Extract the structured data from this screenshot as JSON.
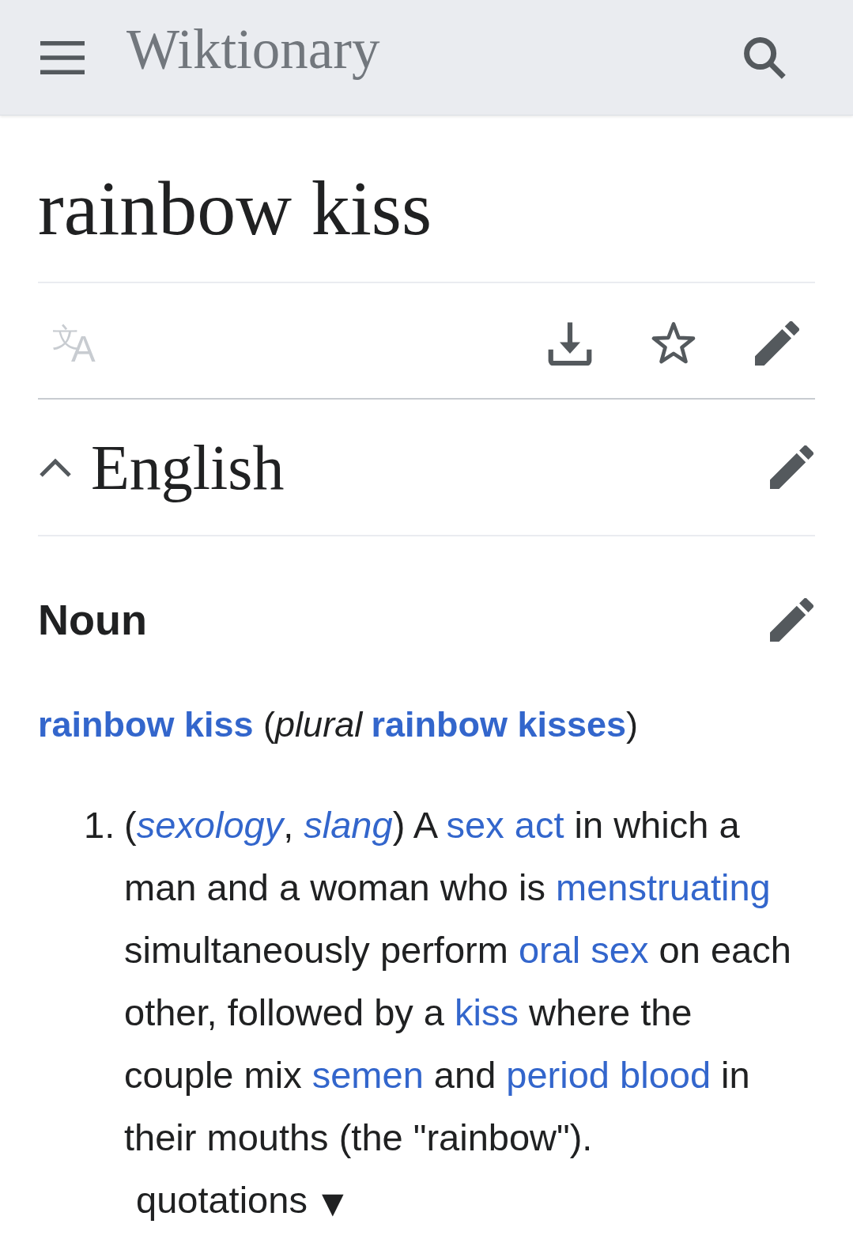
{
  "header": {
    "title": "Wiktionary"
  },
  "page": {
    "title": "rainbow kiss"
  },
  "page_actions": [
    {
      "kind": "language",
      "symbol": "文A",
      "disabled": true
    },
    {
      "kind": "download",
      "disabled": false
    },
    {
      "kind": "watch",
      "disabled": false
    },
    {
      "kind": "edit",
      "disabled": false
    }
  ],
  "section": {
    "heading": "English",
    "expanded": true,
    "subsections": [
      {
        "heading": "Noun",
        "headword_line": [
          {
            "kind": "headword",
            "text": "rainbow kiss"
          },
          {
            "kind": "text",
            "text": " ("
          },
          {
            "kind": "gloss",
            "text": "plural"
          },
          {
            "kind": "headword",
            "text": "rainbow kisses"
          },
          {
            "kind": "text",
            "text": ")"
          }
        ],
        "senses": [
          {
            "number": "1.",
            "segments": [
              {
                "kind": "text",
                "text": "("
              },
              {
                "kind": "label",
                "text": "sexology"
              },
              {
                "kind": "text",
                "text": ", "
              },
              {
                "kind": "label",
                "text": "slang"
              },
              {
                "kind": "text",
                "text": ") A "
              },
              {
                "kind": "link",
                "text": "sex act"
              },
              {
                "kind": "text",
                "text": " in which a man and a woman who is "
              },
              {
                "kind": "link",
                "text": "menstruating"
              },
              {
                "kind": "text",
                "text": " simultaneously perform "
              },
              {
                "kind": "link",
                "text": "oral sex"
              },
              {
                "kind": "text",
                "text": " on each other, followed by a "
              },
              {
                "kind": "link",
                "text": "kiss"
              },
              {
                "kind": "text",
                "text": " where the couple mix "
              },
              {
                "kind": "link",
                "text": "semen"
              },
              {
                "kind": "text",
                "text": " and "
              },
              {
                "kind": "link",
                "text": "period blood"
              },
              {
                "kind": "text",
                "text": " in their mouths (the \"rainbow\")."
              }
            ],
            "quotations_toggle": {
              "label": "quotations",
              "arrow": "▼"
            }
          }
        ]
      }
    ]
  }
}
